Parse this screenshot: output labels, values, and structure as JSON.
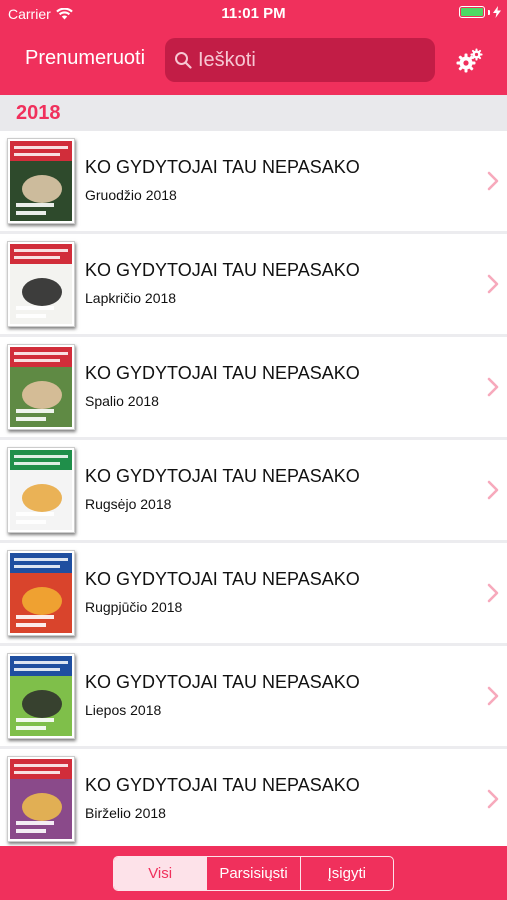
{
  "status_bar": {
    "carrier": "Carrier",
    "time": "11:01 PM",
    "battery_level": 1.0,
    "battery_color": "#4cd964"
  },
  "nav": {
    "subscribe_label": "Prenumeruoti",
    "search_placeholder": "Ieškoti",
    "search_value": "",
    "settings_icon": "gear-icon"
  },
  "colors": {
    "accent": "#f0305c",
    "search_bg": "#c21d46",
    "section_bg": "#e9e9ec"
  },
  "section": {
    "title": "2018"
  },
  "issues": [
    {
      "title": "KO GYDYTOJAI TAU NEPASAKO",
      "subtitle": "Gruodžio 2018",
      "cover_banner": "#d12d3a",
      "cover_bg": "#2e4a2c",
      "cover_blob": "#e7cfb0"
    },
    {
      "title": "KO GYDYTOJAI TAU NEPASAKO",
      "subtitle": "Lapkričio 2018",
      "cover_banner": "#d12d3a",
      "cover_bg": "#f3f3f0",
      "cover_blob": "#1c1c1c"
    },
    {
      "title": "KO GYDYTOJAI TAU NEPASAKO",
      "subtitle": "Spalio 2018",
      "cover_banner": "#d12d3a",
      "cover_bg": "#5f8a44",
      "cover_blob": "#e9c4a4"
    },
    {
      "title": "KO GYDYTOJAI TAU NEPASAKO",
      "subtitle": "Rugsėjo 2018",
      "cover_banner": "#1f8f4a",
      "cover_bg": "#f4f4f4",
      "cover_blob": "#e8a63a"
    },
    {
      "title": "KO GYDYTOJAI TAU NEPASAKO",
      "subtitle": "Rugpjūčio 2018",
      "cover_banner": "#1f4fa0",
      "cover_bg": "#d9442c",
      "cover_blob": "#f2b233"
    },
    {
      "title": "KO GYDYTOJAI TAU NEPASAKO",
      "subtitle": "Liepos 2018",
      "cover_banner": "#1f4fa0",
      "cover_bg": "#7fbf4a",
      "cover_blob": "#2a2a2a"
    },
    {
      "title": "KO GYDYTOJAI TAU NEPASAKO",
      "subtitle": "Birželio 2018",
      "cover_banner": "#d12d3a",
      "cover_bg": "#8a4a8a",
      "cover_blob": "#f0c14a"
    }
  ],
  "filter": {
    "segments": [
      "Visi",
      "Parsisiųsti",
      "Įsigyti"
    ],
    "selected": "Visi"
  }
}
